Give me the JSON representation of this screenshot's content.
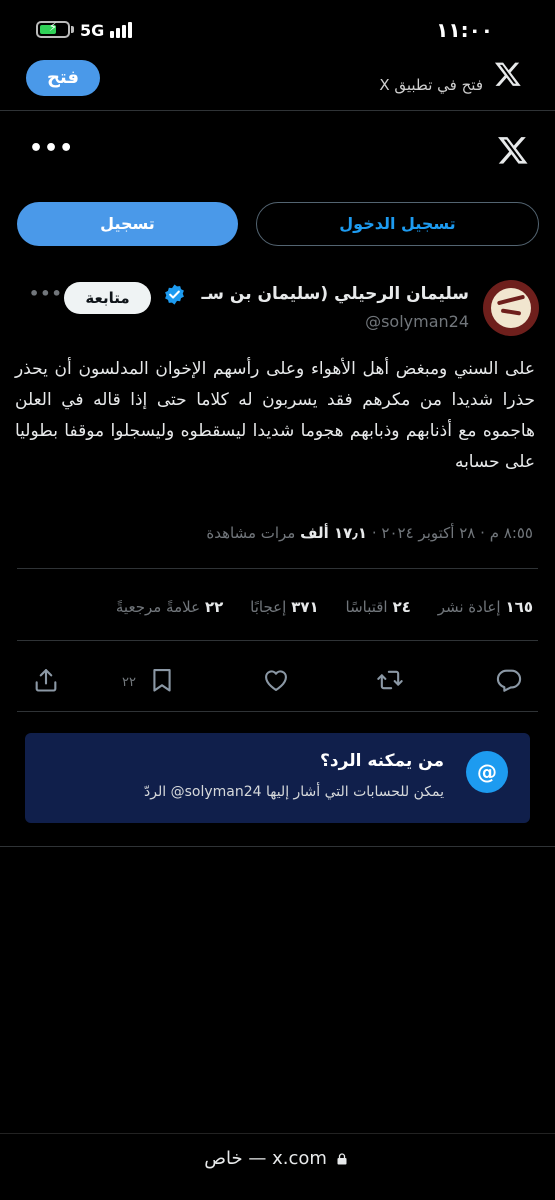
{
  "status_bar": {
    "time": "١١:٠٠",
    "network": "5G",
    "battery_level": 0.6
  },
  "banner": {
    "open_label": "فتح",
    "text": "فتح في تطبيق X"
  },
  "auth": {
    "login_label": "تسجيل الدخول",
    "signup_label": "تسجيل"
  },
  "tweet": {
    "display_name": "سليمان الرحيلي (سليمان بن سـ",
    "username": "@solyman24",
    "follow_label": "متابعة",
    "text": "على السني ومبغض أهل الأهواء وعلى رأسهم الإخوان المدلسون أن يحذر حذرا شديدا من مكرهم فقد يسربون له كلاما حتى إذا قاله في العلن هاجموه مع أذنابهم وذبابهم هجوما شديدا ليسقطوه وليسجلوا موقفا بطوليا على حسابه",
    "time": "٨:٥٥ م",
    "date": "٢٨ أكتوبر ٢٠٢٤",
    "views_count": "١٧٫١ ألف",
    "views_label": "مرات مشاهدة",
    "separator": "·"
  },
  "stats": {
    "retweets_count": "١٦٥",
    "retweets_label": "إعادة نشر",
    "quotes_count": "٢٤",
    "quotes_label": "اقتباسًا",
    "likes_count": "٣٧١",
    "likes_label": "إعجابًا",
    "bookmarks_count": "٢٢",
    "bookmarks_label": "علامةً مرجعيةً"
  },
  "actions": {
    "bookmark_count": "٢٢"
  },
  "reply_settings": {
    "title": "من يمكنه الرد؟",
    "description": "يمكن للحسابات التي أشار إليها solyman24@ الردّ"
  },
  "url_bar": {
    "domain": "x.com",
    "separator": "—",
    "mode": "خاص"
  },
  "colors": {
    "accent": "#1d9bf0",
    "button_blue": "#4a99e9",
    "reply_card_bg": "#101f4b"
  }
}
